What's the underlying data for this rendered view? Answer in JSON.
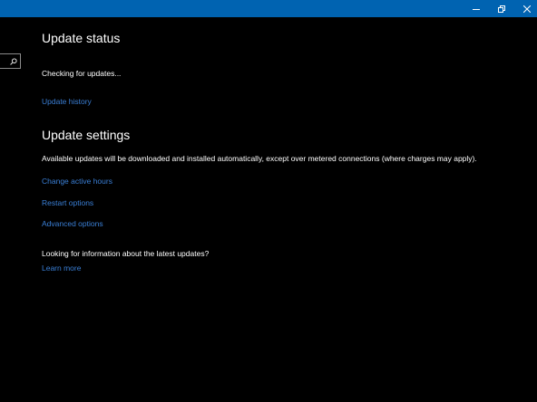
{
  "window": {
    "controls": {
      "minimize_icon": "minimize-icon",
      "maximize_icon": "restore-icon",
      "close_icon": "close-icon"
    },
    "accent_color": "#0063b1"
  },
  "search": {
    "icon": "search-icon"
  },
  "update_status": {
    "heading": "Update status",
    "status_text": "Checking for updates...",
    "history_link": "Update history"
  },
  "update_settings": {
    "heading": "Update settings",
    "description": "Available updates will be downloaded and installed automatically, except over metered connections (where charges may apply).",
    "links": {
      "active_hours": "Change active hours",
      "restart": "Restart options",
      "advanced": "Advanced options"
    }
  },
  "info": {
    "question": "Looking for information about the latest updates?",
    "learn_more": "Learn more"
  },
  "colors": {
    "background": "#000000",
    "link": "#3a7fd6",
    "text": "#ffffff"
  }
}
